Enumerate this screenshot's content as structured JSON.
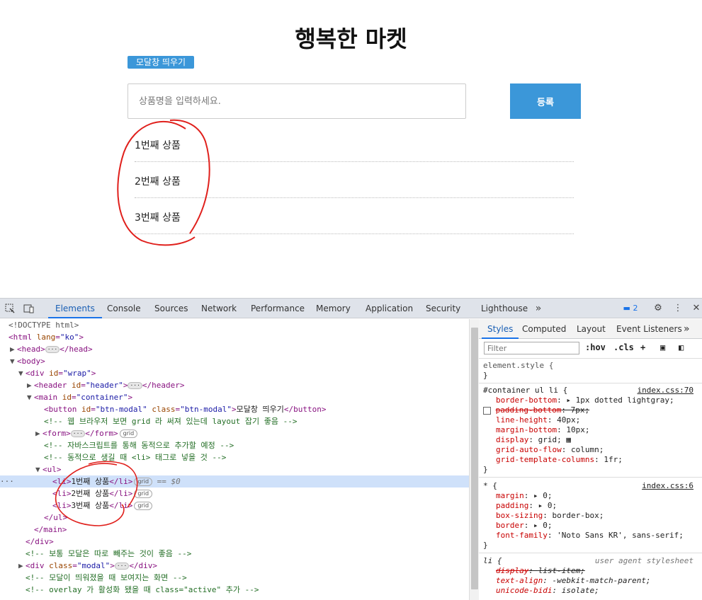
{
  "page": {
    "title": "행복한 마켓",
    "modal_button": "모달창 띄우기",
    "input_placeholder": "상품명을 입력하세요.",
    "register_button": "등록",
    "items": [
      "1번째 상품",
      "2번째 상품",
      "3번째 상품"
    ]
  },
  "devtools": {
    "tabs": [
      "Elements",
      "Console",
      "Sources",
      "Network",
      "Performance",
      "Memory",
      "Application",
      "Security",
      "Lighthouse"
    ],
    "active_tab": "Elements",
    "issues_count": "2",
    "elements_lines": {
      "doctype": "<!DOCTYPE html>",
      "html_tag": "<html ",
      "html_attr": "lang",
      "html_val": "\"ko\"",
      "head": "<head>",
      "head_close": "</head>",
      "body": "<body>",
      "div_wrap_open": "<div ",
      "id_attr": "id",
      "wrap_val": "\"wrap\"",
      "header_open": "<header ",
      "header_val": "\"header\"",
      "header_close": "</header>",
      "main_open": "<main ",
      "container_val": "\"container\"",
      "button_open": "<button ",
      "btn_id_val": "\"btn-modal\"",
      "class_attr": "class",
      "btn_class_val": "\"btn-modal\"",
      "button_text": "모달창 띄우기",
      "button_close": "</button>",
      "comment1": "<!-- 웹 브라우저 보면 grid 라 써져 있는데 layout 잡기 좋음 -->",
      "form_open": "<form>",
      "form_close": "</form>",
      "comment2": "<!-- 자바스크립트를 통해 동적으로 추가할 예정 -->",
      "comment3": "<!-- 동적으로 생길 때 <li> 태그로 넣을 것 -->",
      "ul_open": "<ul>",
      "li_open": "<li>",
      "li_close": "</li>",
      "li_texts": [
        "1번째 상품",
        "2번째 상품",
        "3번째 상품"
      ],
      "ul_close": "</ul>",
      "main_close": "</main>",
      "div_close": "</div>",
      "comment4": "<!-- 보통 모달은 따로 빼주는 것이 좋음 -->",
      "div_modal_val": "\"modal\"",
      "comment5": "<!-- 모달이 띄워졌을 때 보여지는 화면 -->",
      "comment6": "<!-- overlay 가 활성화 됐을 때 class=\"active\" 추가 -->",
      "grid_badge": "grid",
      "selected_marker": "== $0"
    },
    "styles_panel": {
      "tabs": [
        "Styles",
        "Computed",
        "Layout",
        "Event Listeners"
      ],
      "active_tab": "Styles",
      "filter_placeholder": "Filter",
      "hov": ":hov",
      "cls": ".cls",
      "element_style": "element.style {",
      "close_brace": "}",
      "rule1_selector": "#container ul li {",
      "rule1_source": "index.css:70",
      "rule1_props": [
        {
          "name": "border-bottom",
          "value": "▸ 1px dotted  lightgray;"
        },
        {
          "name": "padding-bottom",
          "value": "7px;"
        },
        {
          "name": "line-height",
          "value": "40px;"
        },
        {
          "name": "margin-bottom",
          "value": "10px;"
        },
        {
          "name": "display",
          "value": "grid;"
        },
        {
          "name": "grid-auto-flow",
          "value": "column;"
        },
        {
          "name": "grid-template-columns",
          "value": "1fr;"
        }
      ],
      "rule2_selector": "* {",
      "rule2_source": "index.css:6",
      "rule2_props": [
        {
          "name": "margin",
          "value": "▸ 0;"
        },
        {
          "name": "padding",
          "value": "▸ 0;"
        },
        {
          "name": "box-sizing",
          "value": "border-box;"
        },
        {
          "name": "border",
          "value": "▸ 0;"
        },
        {
          "name": "font-family",
          "value": "'Noto Sans KR', sans-serif;"
        }
      ],
      "rule3_selector": "li {",
      "rule3_source": "user agent stylesheet",
      "rule3_props": [
        {
          "name": "display",
          "value": "list-item;"
        },
        {
          "name": "text-align",
          "value": "-webkit-match-parent;"
        },
        {
          "name": "unicode-bidi",
          "value": "isolate;"
        }
      ]
    }
  },
  "colors": {
    "accent": "#3b97d9",
    "annotation": "#e0201c"
  }
}
